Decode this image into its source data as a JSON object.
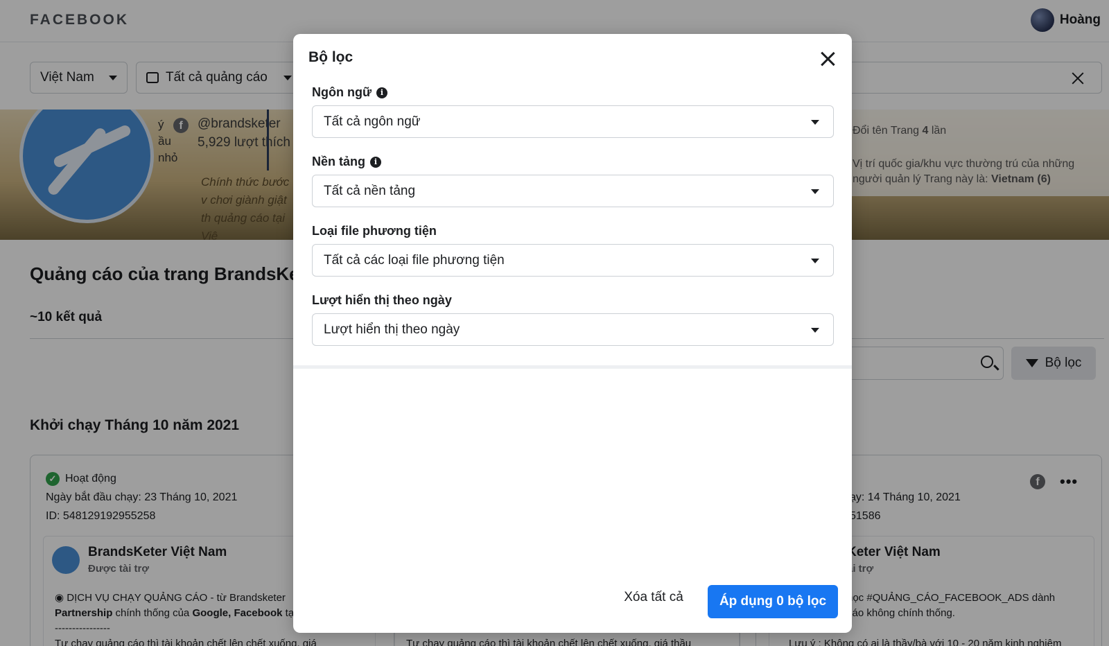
{
  "header": {
    "logo": "FACEBOOK",
    "user_name": "Hoàng"
  },
  "filterbar": {
    "country": "Việt Nam",
    "ad_type": "Tất cả quảng cáo"
  },
  "banner": {
    "side_text_1": "ý",
    "side_text_2": "ầu",
    "side_text_3": "nhỏ",
    "fb_icon": "f",
    "handle": "@brandsketer",
    "likes": "5,929 lượt thích",
    "promo": "Chính thức bước v chơi giành giật th quảng cáo tại Việ",
    "rename_prefix": "Đổi tên Trang ",
    "rename_count": "4",
    "rename_suffix": " lần",
    "location_text": "Vị trí quốc gia/khu vực thường trú của những người quản lý Trang này là: ",
    "location_value": "Vietnam (6)"
  },
  "main": {
    "title": "Quảng cáo của trang BrandsKet",
    "result_count": "~10 kết quả",
    "filter_button": "Bộ lọc",
    "month_title": "Khởi chạy Tháng 10 năm 2021"
  },
  "cards": {
    "left": {
      "status": "Hoạt động",
      "start_date": "Ngày bắt đầu chạy: 23 Tháng 10, 2021",
      "id": "ID: 548129192955258",
      "brand": "BrandsKeter Việt Nam",
      "sponsored": "Được tài trợ",
      "text_1": "◉ DỊCH VỤ CHẠY QUẢNG CÁO - từ Brandsketer",
      "text_2_bold_1": "Partnership",
      "text_2_mid": " chính thống của ",
      "text_2_bold_2": "Google, Facebook",
      "text_2_end": " tại",
      "text_3": "----------------",
      "text_4": "Tự chạy quảng cáo thì tài khoản chết lên chết xuống, giá"
    },
    "mid": {
      "text_4": "Tự chạy quảng cáo thì tài khoản chết lên chết xuống, giá thầu"
    },
    "right": {
      "start_date": "ạy: 14 Tháng 10, 2021",
      "id": "51586",
      "brand": "Keter Việt Nam",
      "sponsored": "ài trợ",
      "text_1": "học #QUẢNG_CÁO_FACEBOOK_ADS dành",
      "text_2": "cáo không chính thống.",
      "text_4": "Lưu ý : Không có ai là thầy/bà với 10 - 20 năm kinh nghiệm"
    }
  },
  "modal": {
    "title": "Bộ lọc",
    "fields": [
      {
        "label": "Ngôn ngữ",
        "value": "Tất cả ngôn ngữ",
        "has_info": true
      },
      {
        "label": "Nền tảng",
        "value": "Tất cả nền tảng",
        "has_info": true
      },
      {
        "label": "Loại file phương tiện",
        "value": "Tất cả các loại file phương tiện",
        "has_info": false
      },
      {
        "label": "Lượt hiển thị theo ngày",
        "value": "Lượt hiển thị theo ngày",
        "has_info": false
      }
    ],
    "info_glyph": "i",
    "clear_button": "Xóa tất cả",
    "apply_button": "Áp dụng 0 bộ lọc"
  }
}
